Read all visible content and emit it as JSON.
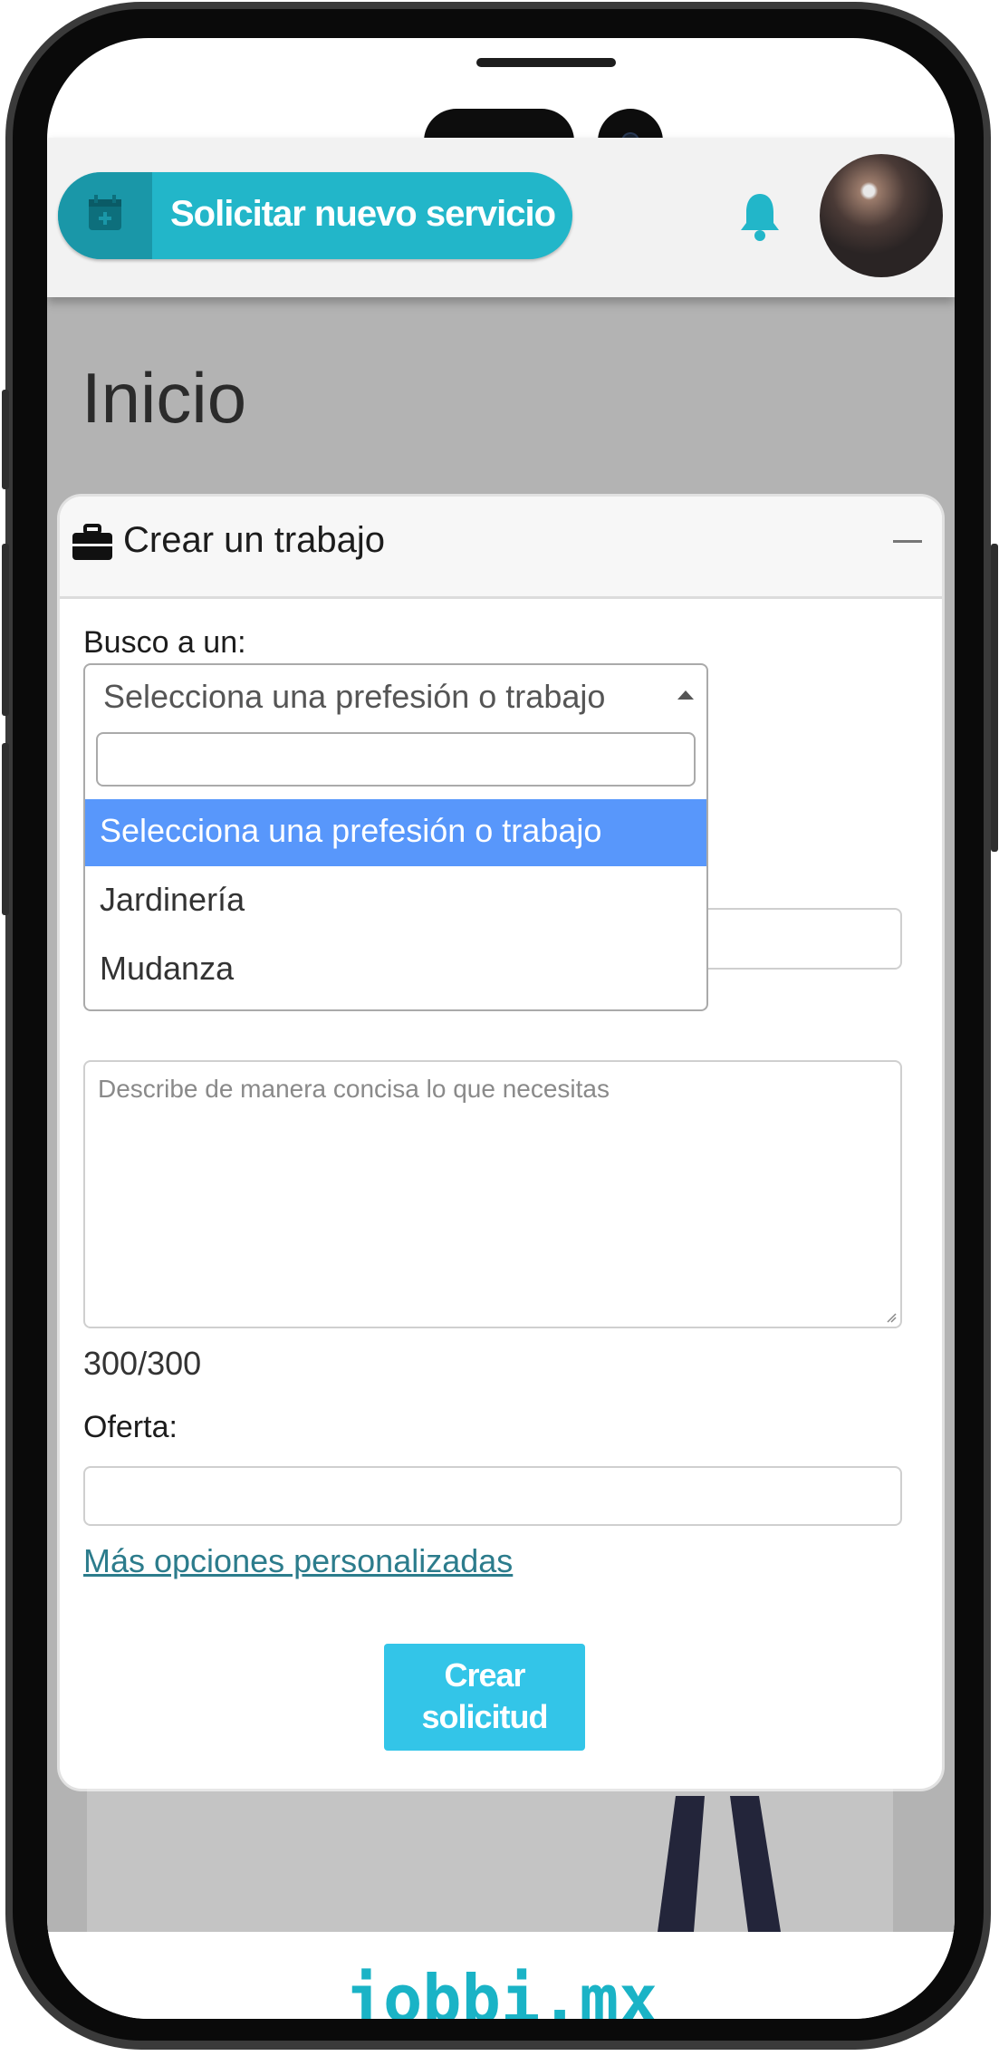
{
  "header": {
    "new_service_label": "Solicitar nuevo servicio"
  },
  "page": {
    "title": "Inicio"
  },
  "card": {
    "title": "Crear un trabajo",
    "busco_label": "Busco a un:",
    "select_value": "Selecciona una prefesión o trabajo",
    "dropdown_options": [
      "Selecciona una prefesión o trabajo",
      "Jardinería",
      "Mudanza"
    ],
    "description_placeholder": "Describe de manera concisa lo que necesitas",
    "char_counter": "300/300",
    "oferta_label": "Oferta:",
    "more_options_link": "Más opciones personalizadas",
    "create_button_line1": "Crear",
    "create_button_line2": "solicitud"
  },
  "footer": {
    "brand": "jobbi.mx"
  },
  "colors": {
    "accent": "#22b6c9",
    "selected_option": "#5897fb",
    "button": "#33c5e8"
  }
}
